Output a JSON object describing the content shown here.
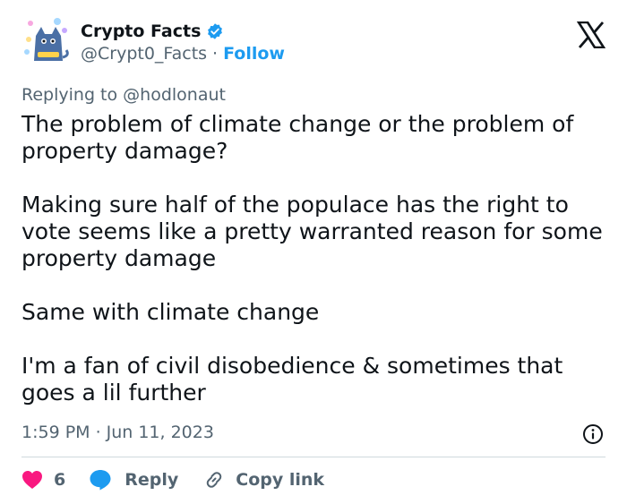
{
  "author": {
    "display_name": "Crypto Facts",
    "handle": "@Crypt0_Facts",
    "separator": "·",
    "follow_label": "Follow",
    "verified": true,
    "avatar_icon": "cat-avatar-icon"
  },
  "platform": {
    "logo": "x-logo-icon"
  },
  "reply_context": {
    "prefix": "Replying to",
    "mention": "@hodlonaut"
  },
  "tweet": {
    "paragraphs": [
      "The problem of climate change or the problem of property damage?",
      "Making sure half of the populace has the right to vote seems like a pretty warranted reason for some property damage",
      "Same with climate change",
      "I'm a fan of civil disobedience & sometimes that goes a lil further"
    ]
  },
  "meta": {
    "time": "1:59 PM",
    "separator": "·",
    "date": "Jun 11, 2023",
    "info_icon": "info-icon"
  },
  "actions": {
    "like_count": "6",
    "reply_label": "Reply",
    "copy_link_label": "Copy link"
  },
  "colors": {
    "accent": "#1d9bf0",
    "like": "#f91880",
    "text": "#0f1419",
    "secondary": "#536471",
    "divider": "#cfd9de"
  }
}
